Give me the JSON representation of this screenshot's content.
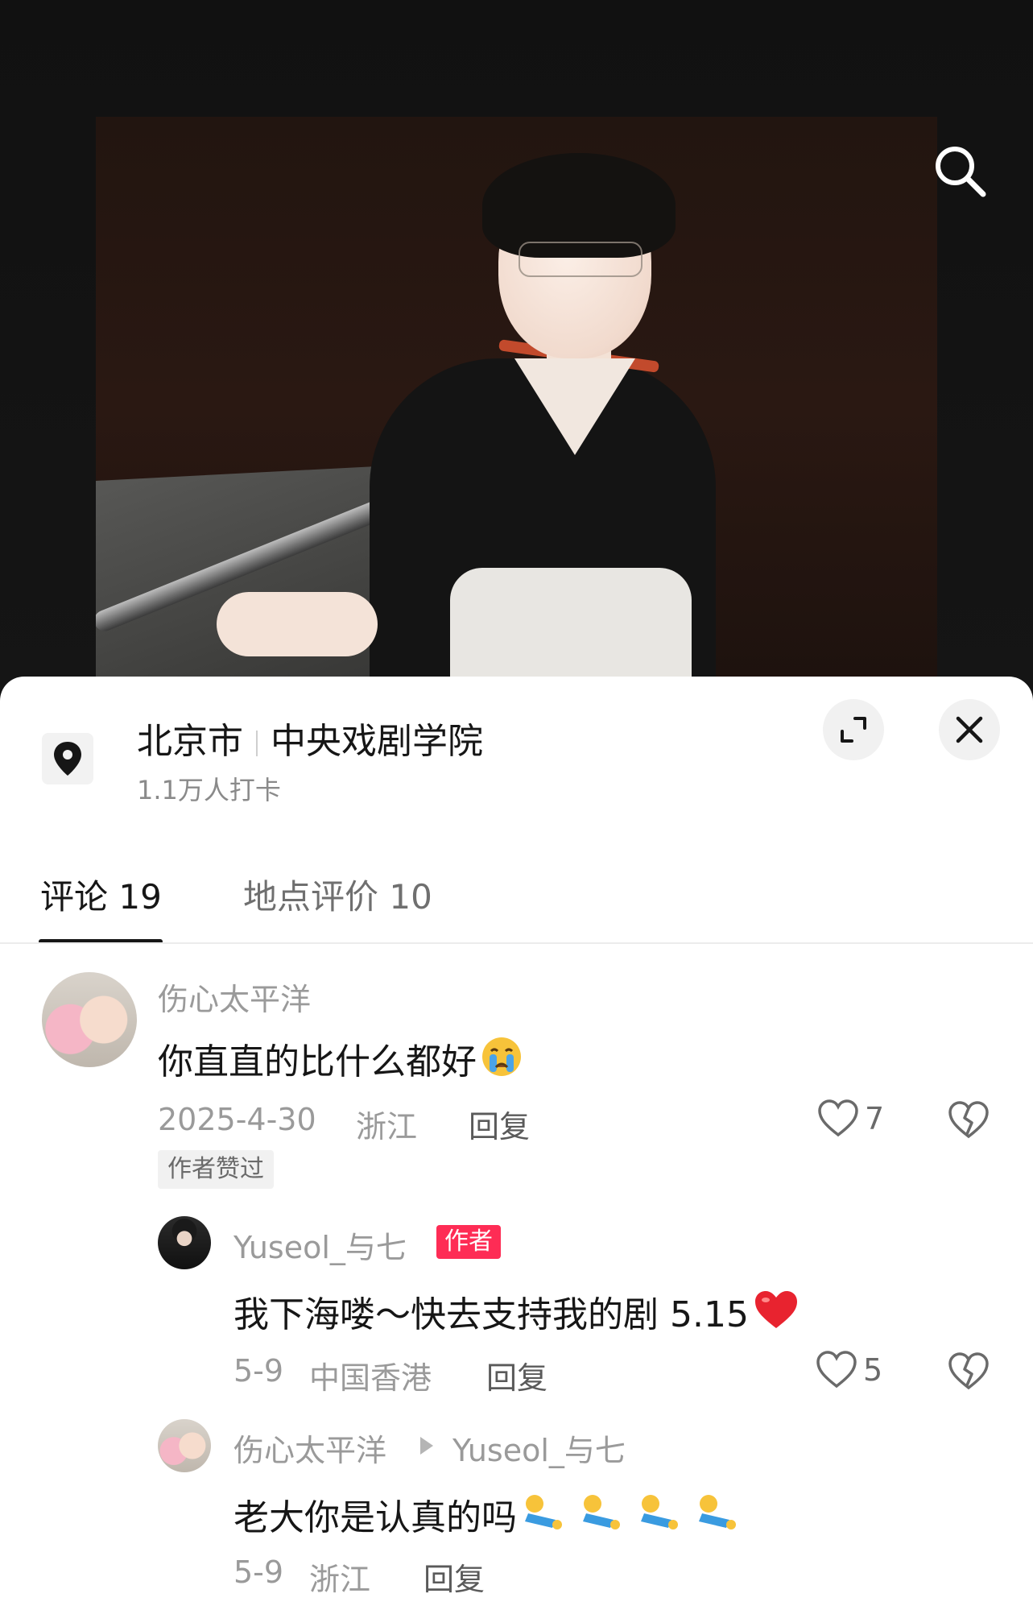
{
  "location": {
    "city": "北京市",
    "place": "中央戏剧学院",
    "checkins": "1.1万人打卡"
  },
  "tabs": [
    {
      "label": "评论 19"
    },
    {
      "label": "地点评价 10"
    }
  ],
  "comments": [
    {
      "user": "伤心太平洋",
      "text": "你直直的比什么都好",
      "date": "2025-4-30",
      "region": "浙江",
      "reply_label": "回复",
      "likes": "7",
      "badge": "作者赞过"
    }
  ],
  "replies": [
    {
      "user": "Yuseol_与七",
      "author_badge": "作者",
      "text": "我下海喽～快去支持我的剧 5.15",
      "date": "5-9",
      "region": "中国香港",
      "reply_label": "回复",
      "likes": "5"
    },
    {
      "user": "伤心太平洋",
      "reply_to": "Yuseol_与七",
      "text": "老大你是认真的吗",
      "date": "5-9",
      "region": "浙江",
      "reply_label": "回复"
    }
  ],
  "icons": {
    "search": "search-icon",
    "pin": "location-pin-icon",
    "expand": "expand-icon",
    "close": "close-icon",
    "like": "heart-outline-icon",
    "dislike": "broken-heart-icon"
  },
  "colors": {
    "accent": "#fe2c55",
    "text_primary": "#161616",
    "text_secondary": "#9a9a9a"
  }
}
